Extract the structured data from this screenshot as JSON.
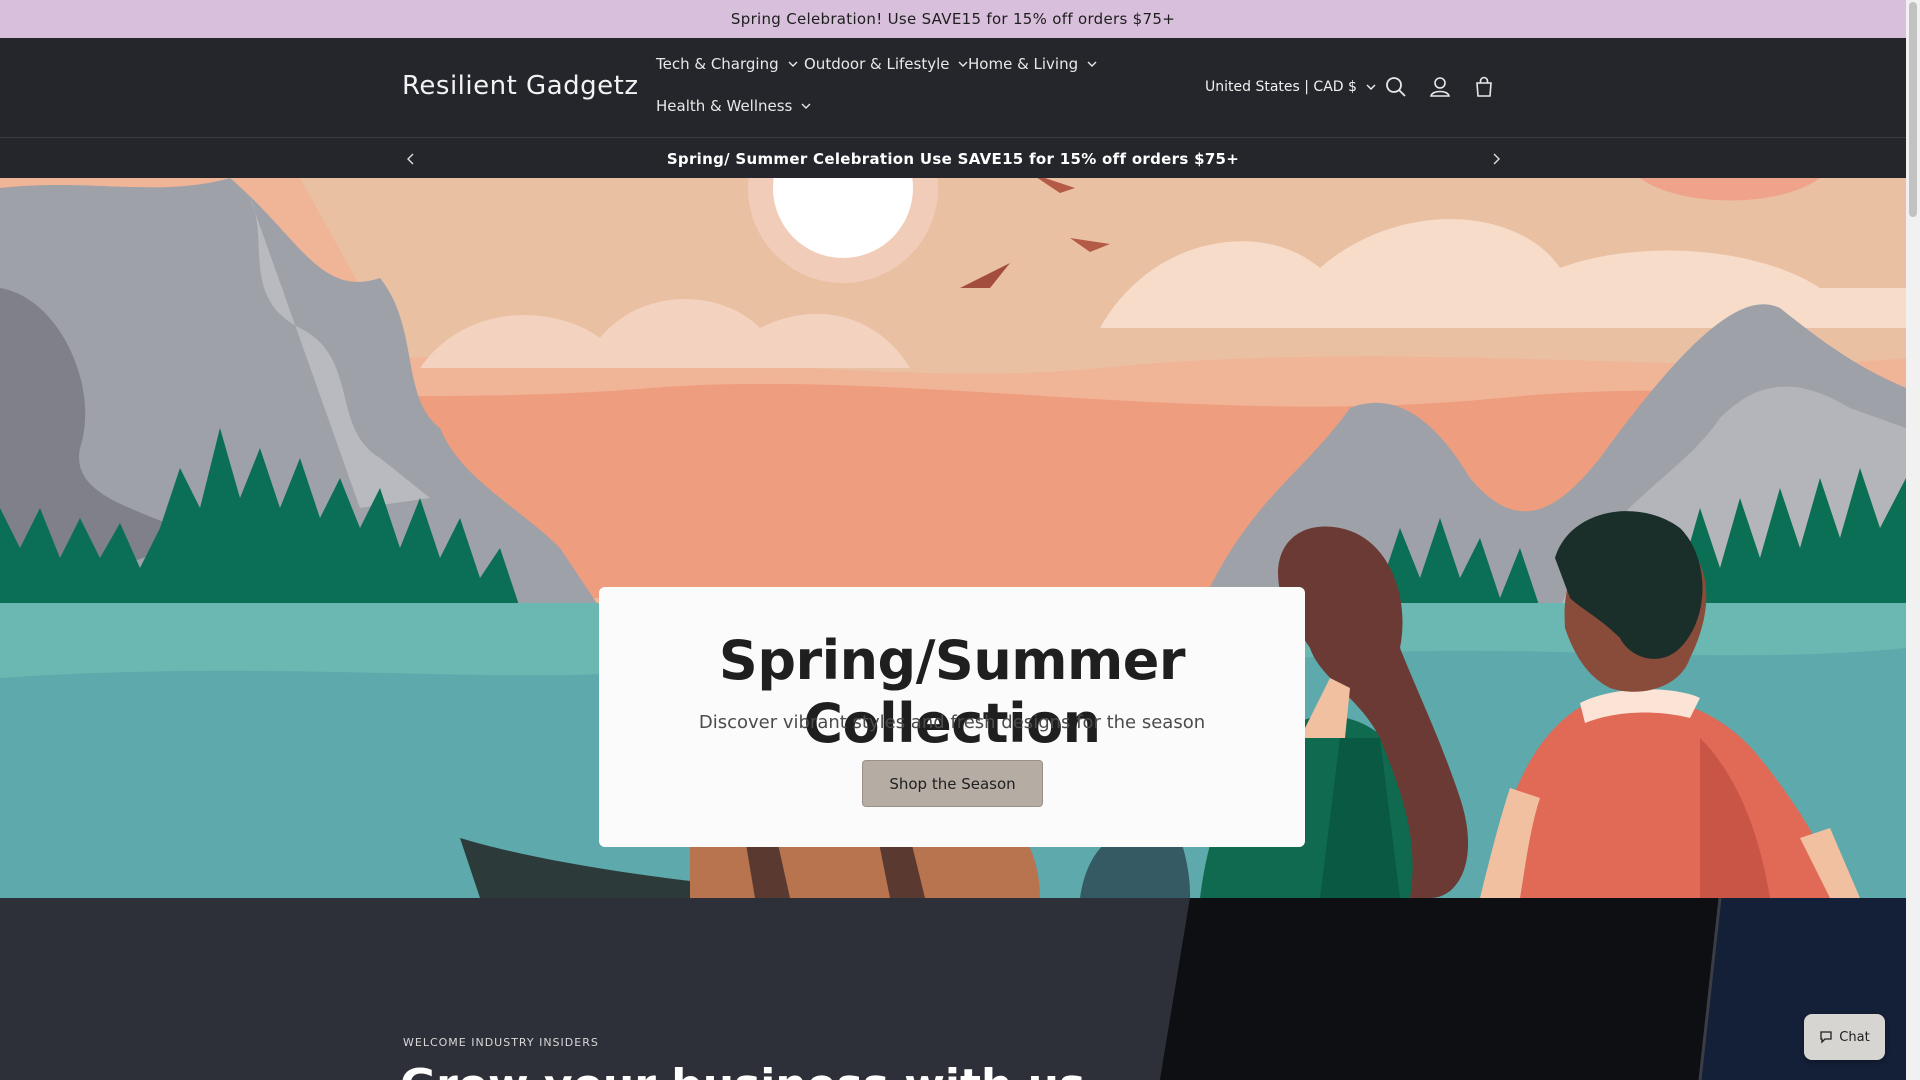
{
  "announcement_top": "Spring Celebration! Use SAVE15 for 15% off orders $75+",
  "header": {
    "logo": "Resilient Gadgetz",
    "nav": [
      {
        "label": "Tech & Charging"
      },
      {
        "label": "Outdoor & Lifestyle"
      },
      {
        "label": "Home & Living"
      },
      {
        "label": "Health & Wellness"
      }
    ],
    "country_selector": "United States | CAD $",
    "icons": [
      "search-icon",
      "account-icon",
      "cart-icon"
    ]
  },
  "announcement_bar": {
    "text": "Spring/ Summer Celebration Use SAVE15 for 15% off orders $75+"
  },
  "hero": {
    "title": "Spring/Summer Collection",
    "subtitle": "Discover vibrant styles and fresh designs for the season",
    "button": "Shop the Season"
  },
  "section2": {
    "eyebrow": "WELCOME INDUSTRY INSIDERS",
    "heading": "Grow your business with us"
  },
  "chat": {
    "label": "Chat"
  },
  "colors": {
    "announcement_bg": "#d8bfdb",
    "header_bg": "#24262b",
    "button_bg": "#b5aca3"
  }
}
